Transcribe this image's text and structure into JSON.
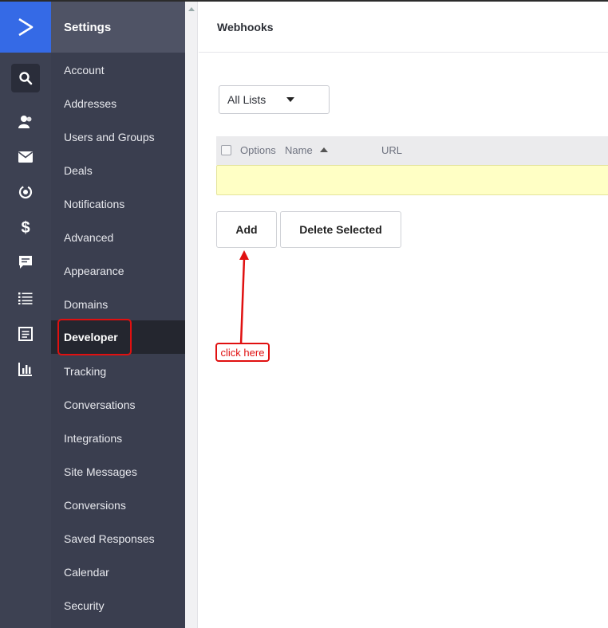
{
  "rail": {
    "icons": [
      "logo-icon",
      "search-icon",
      "contacts-icon",
      "email-icon",
      "automation-icon",
      "deals-icon",
      "conversations-icon",
      "lists-icon",
      "forms-icon",
      "reports-icon"
    ],
    "colors": {
      "background": "#3d4152",
      "logo_bg": "#356ae6"
    }
  },
  "sidebar": {
    "title": "Settings",
    "items": [
      {
        "label": "Account"
      },
      {
        "label": "Addresses"
      },
      {
        "label": "Users and Groups"
      },
      {
        "label": "Deals"
      },
      {
        "label": "Notifications"
      },
      {
        "label": "Advanced"
      },
      {
        "label": "Appearance"
      },
      {
        "label": "Domains"
      },
      {
        "label": "Developer",
        "active": true
      },
      {
        "label": "Tracking"
      },
      {
        "label": "Conversations"
      },
      {
        "label": "Integrations"
      },
      {
        "label": "Site Messages"
      },
      {
        "label": "Conversions"
      },
      {
        "label": "Saved Responses"
      },
      {
        "label": "Calendar"
      },
      {
        "label": "Security"
      }
    ]
  },
  "main": {
    "title": "Webhooks",
    "list_filter": {
      "selected": "All Lists"
    },
    "table": {
      "columns": [
        "Options",
        "Name",
        "URL"
      ],
      "sort_column": "Name",
      "rows": []
    },
    "buttons": {
      "add": "Add",
      "delete_selected": "Delete Selected"
    }
  },
  "annotation": {
    "label": "click here",
    "color": "#e01010"
  }
}
